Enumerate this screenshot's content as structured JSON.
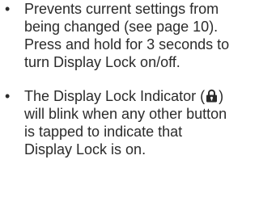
{
  "bullets": [
    {
      "text": "Prevents current settings from being changed (see page 10). Press and hold for 3 seconds to turn Display Lock on/off."
    },
    {
      "text_before_icon": "The Display Lock Indicator (",
      "icon": "padlock-icon",
      "text_after_icon": ") will blink when any other button is tapped to indicate that Display Lock is on."
    }
  ],
  "colors": {
    "text": "#2b2b2b"
  }
}
